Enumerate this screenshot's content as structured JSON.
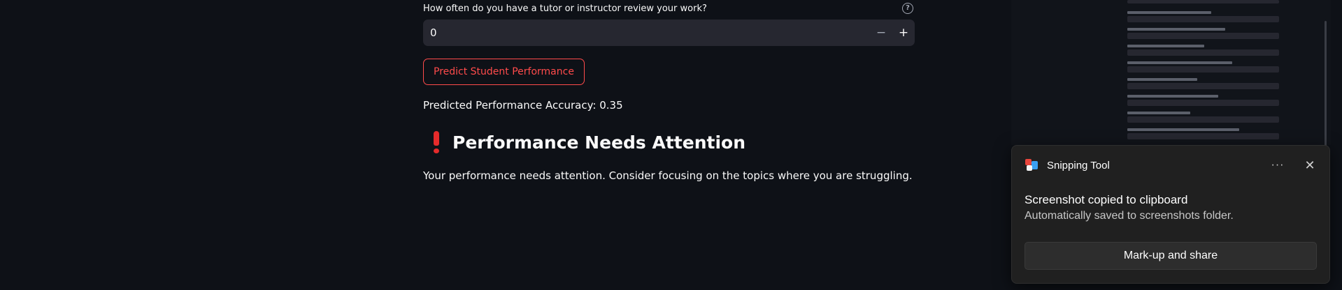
{
  "form": {
    "question_label": "How often do you have a tutor or instructor review your work?",
    "help_icon": "question-circle-icon",
    "input_value": "0",
    "minus_symbol": "−",
    "plus_symbol": "+",
    "predict_button": "Predict Student Performance"
  },
  "result": {
    "accuracy_text": "Predicted Performance Accuracy: 0.35",
    "heading_icon": "exclamation-icon",
    "heading": "Performance Needs Attention",
    "message": "Your performance needs attention. Consider focusing on the topics where you are struggling."
  },
  "toast": {
    "app_name": "Snipping Tool",
    "more_symbol": "···",
    "close_symbol": "✕",
    "title": "Screenshot copied to clipboard",
    "subtitle": "Automatically saved to screenshots folder.",
    "action_button": "Mark-up and share"
  },
  "colors": {
    "background": "#0e1117",
    "accent": "#ff4b4b",
    "input_bg": "#262730",
    "toast_bg": "#202020"
  }
}
